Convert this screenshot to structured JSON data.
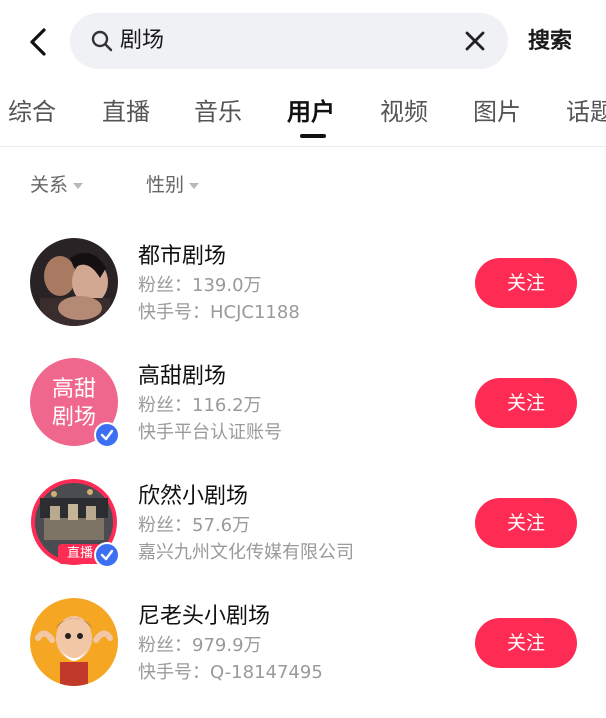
{
  "header": {
    "query": "剧场",
    "search_label": "搜索",
    "back_icon": "chevron-left-icon",
    "search_icon": "search-icon",
    "clear_icon": "close-icon"
  },
  "tabs": [
    {
      "label": "综合"
    },
    {
      "label": "直播"
    },
    {
      "label": "音乐"
    },
    {
      "label": "用户",
      "active": true
    },
    {
      "label": "视频"
    },
    {
      "label": "图片"
    },
    {
      "label": "话题"
    }
  ],
  "filters": {
    "relation": "关系",
    "gender": "性别"
  },
  "users": [
    {
      "name": "都市剧场",
      "fans": "粉丝：139.0万",
      "info": "快手号：HCJC1188",
      "follow": "关注"
    },
    {
      "name": "高甜剧场",
      "fans": "粉丝：116.2万",
      "info": "快手平台认证账号",
      "follow": "关注",
      "avatar_text_top": "高甜",
      "avatar_text_bottom": "剧场"
    },
    {
      "name": "欣然小剧场",
      "fans": "粉丝：57.6万",
      "info": "嘉兴九州文化传媒有限公司",
      "follow": "关注",
      "live": "直播"
    },
    {
      "name": "尼老头小剧场",
      "fans": "粉丝：979.9万",
      "info": "快手号：Q-18147495",
      "follow": "关注"
    }
  ],
  "colors": {
    "accent": "#fe2c55",
    "verified": "#3d6ff2"
  }
}
